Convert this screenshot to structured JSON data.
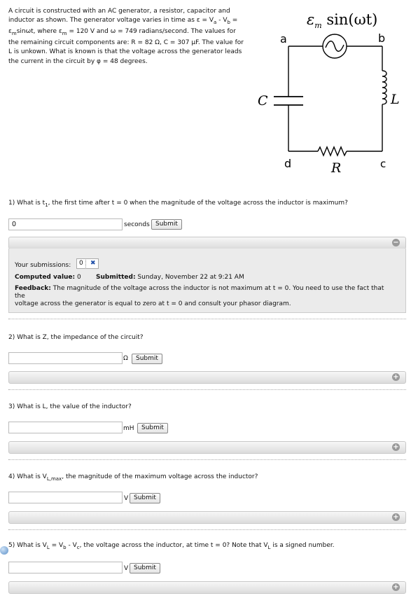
{
  "intro": {
    "line1": "A circuit is constructed with an AC generator, a resistor, capacitor and",
    "line2_pre": "inductor as shown. The generator voltage varies in time as ε = V",
    "line2_sub_a": "a",
    "line2_mid": " - V",
    "line2_sub_b": "b",
    "line2_post": " =",
    "line3_pre": "ε",
    "line3_sub": "m",
    "line3_mid1": "sinωt, where ε",
    "line3_sub2": "m",
    "line3_post": " = 120 V and ω = 749 radians/second. The values for",
    "line4": "the remaining circuit components are: R = 82 Ω, C = 307 μF. The value for",
    "line5": "L is unkown. What is known is that the voltage across the generator leads",
    "line6": "the current in the circuit by φ = 48 degrees."
  },
  "circuit": {
    "emf_label": "ε",
    "emf_sub": "m",
    "emf_fn": " sin(ωt)",
    "node_a": "a",
    "node_b": "b",
    "node_c": "c",
    "node_d": "d",
    "cap_label": "C",
    "ind_label": "L",
    "res_label": "R"
  },
  "q1": {
    "text_pre": "1) What is t",
    "text_sub": "1",
    "text_post": ", the first time after t = 0 when the magnitude of the voltage across the inductor is maximum?",
    "value": "0",
    "unit": "seconds",
    "submit": "Submit",
    "toggle": "−",
    "submissions_label": "Your submissions:",
    "submission_value": "0",
    "submission_mark": "✖",
    "computed_label": "Computed value:",
    "computed_value": "0",
    "submitted_label": "Submitted:",
    "submitted_value": "Sunday, November 22 at 9:21 AM",
    "feedback_label": "Feedback:",
    "feedback_line1": "The magnitude of the voltage across the inductor is not maximum at t = 0. You need to use the fact that the",
    "feedback_line2": "voltage across the generator is equal to zero at t = 0 and consult your phasor diagram."
  },
  "q2": {
    "text": "2) What is Z, the impedance of the circuit?",
    "value": "",
    "unit": "Ω",
    "submit": "Submit",
    "toggle": "+"
  },
  "q3": {
    "text": "3) What is L, the value of the inductor?",
    "value": "",
    "unit": "mH",
    "submit": "Submit",
    "toggle": "+"
  },
  "q4": {
    "text_pre": "4) What is V",
    "text_sub": "L,max",
    "text_post": ", the magnitude of the maximum voltage across the inductor?",
    "value": "",
    "unit": "V",
    "submit": "Submit",
    "toggle": "+"
  },
  "q5": {
    "p1": "5) What is V",
    "s1": "L",
    "p2": " = V",
    "s2": "b",
    "p3": " - V",
    "s3": "c",
    "p4": ", the voltage across the inductor, at time t = 0? Note that V",
    "s4": "L",
    "p5": " is a signed number.",
    "value": "",
    "unit": "V",
    "submit": "Submit",
    "toggle": "+"
  }
}
